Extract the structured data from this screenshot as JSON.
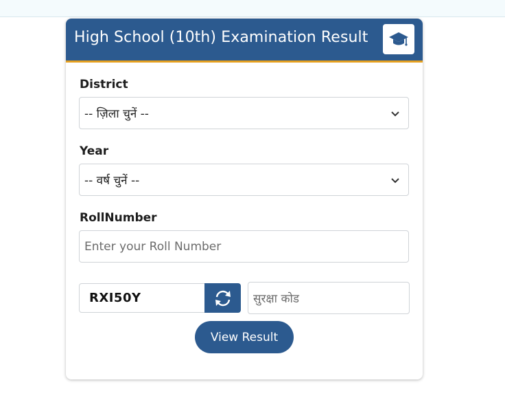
{
  "header": {
    "title": "High School (10th) Examination Result",
    "icon": "graduation-cap-icon"
  },
  "form": {
    "district": {
      "label": "District",
      "selected": "-- ज़िला चुनें --"
    },
    "year": {
      "label": "Year",
      "selected": "-- वर्ष चुनें --"
    },
    "roll_number": {
      "label": "RollNumber",
      "placeholder": "Enter your Roll Number"
    },
    "captcha": {
      "code": "RXI50Y",
      "refresh_icon": "refresh-icon",
      "security_placeholder": "सुरक्षा कोड"
    },
    "submit_label": "View Result"
  },
  "colors": {
    "header_bg": "#2c5a8f",
    "header_border": "#e5a020",
    "button_bg": "#2c5a8f"
  }
}
